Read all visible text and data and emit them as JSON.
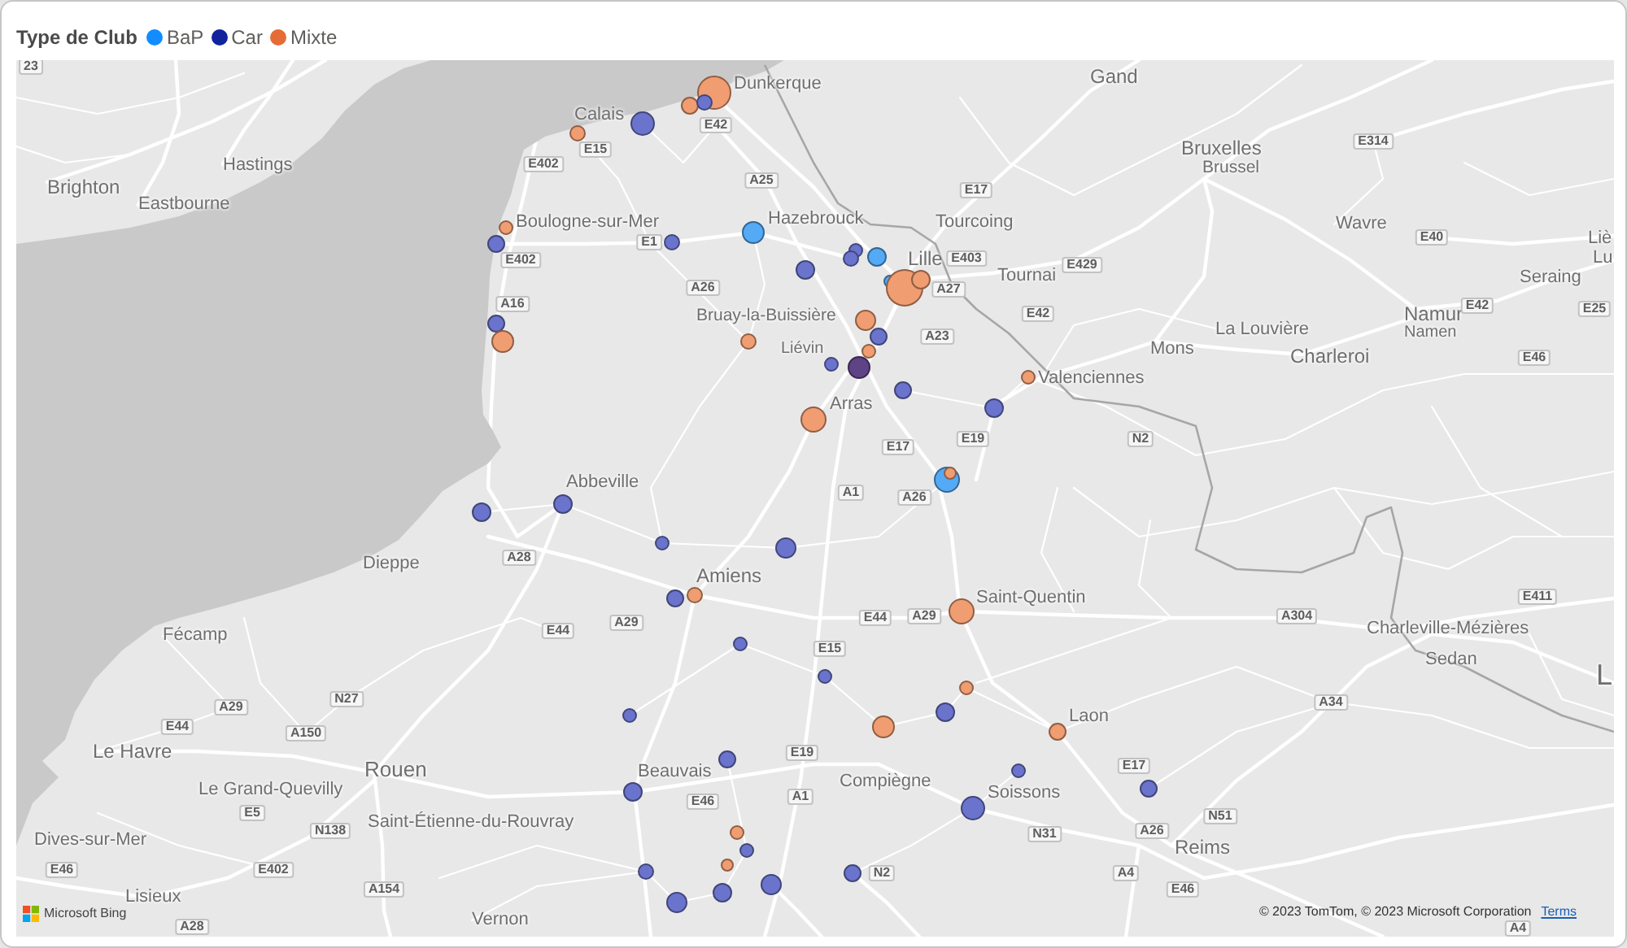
{
  "legend": {
    "title": "Type de Club",
    "items": [
      {
        "label": "BaP",
        "color": "#118dff"
      },
      {
        "label": "Car",
        "color": "#12239e"
      },
      {
        "label": "Mixte",
        "color": "#e66c37"
      }
    ]
  },
  "map": {
    "places": [
      "Dunkerque",
      "Gand",
      "Calais",
      "Bruxelles",
      "Hastings",
      "Brussel",
      "Brighton",
      "Eastbourne",
      "Boulogne-sur-Mer",
      "Hazebrouck",
      "Tourcoing",
      "Wavre",
      "Liè",
      "Lille",
      "Lu",
      "Tournai",
      "Seraing",
      "Bruay-la-Buissière",
      "Namur",
      "La Louvière",
      "Namen",
      "Liévin",
      "Mons",
      "Charleroi",
      "Valenciennes",
      "Arras",
      "Abbeville",
      "Dieppe",
      "Amiens",
      "Saint-Quentin",
      "Fécamp",
      "Charleville-Mézières",
      "Sedan",
      "L",
      "Laon",
      "Le Havre",
      "Rouen",
      "Beauvais",
      "Le Grand-Quevilly",
      "Compiègne",
      "Soissons",
      "Saint-Étienne-du-Rouvray",
      "Dives-sur-Mer",
      "Reims",
      "Lisieux",
      "Vernon"
    ],
    "road_signs": [
      "23",
      "E42",
      "E15",
      "E314",
      "E402",
      "A25",
      "E17",
      "E1",
      "E40",
      "E402",
      "E403",
      "E429",
      "A26",
      "A27",
      "A16",
      "E42",
      "E42",
      "E25",
      "A23",
      "E46",
      "E17",
      "E19",
      "N2",
      "A1",
      "A26",
      "A28",
      "E411",
      "E44",
      "A29",
      "E44",
      "A29",
      "A304",
      "E15",
      "A29",
      "N27",
      "A34",
      "E44",
      "A150",
      "E19",
      "E17",
      "E46",
      "A1",
      "E5",
      "N51",
      "N138",
      "N31",
      "A26",
      "E46",
      "E402",
      "N2",
      "A4",
      "A154",
      "E46",
      "A28",
      "A4"
    ],
    "bubbles": [
      {
        "color": "#f09d72"
      },
      {
        "color": "#f09d72"
      },
      {
        "color": "#6b74cc"
      },
      {
        "color": "#6b74cc"
      },
      {
        "color": "#f09d72"
      },
      {
        "color": "#f09d72"
      },
      {
        "color": "#55aaf5"
      },
      {
        "color": "#6b74cc"
      },
      {
        "color": "#6b74cc"
      },
      {
        "color": "#6b74cc"
      },
      {
        "color": "#6b74cc"
      },
      {
        "color": "#55aaf5"
      },
      {
        "color": "#6b74cc"
      },
      {
        "color": "#55aaf5"
      },
      {
        "color": "#f09d72"
      },
      {
        "color": "#f09d72"
      },
      {
        "color": "#f09d72"
      },
      {
        "color": "#6b74cc"
      },
      {
        "color": "#6b74cc"
      },
      {
        "color": "#f09d72"
      },
      {
        "color": "#f09d72"
      },
      {
        "color": "#f09d72"
      },
      {
        "color": "#6b74cc"
      },
      {
        "color": "#5e4387"
      },
      {
        "color": "#f09d72"
      },
      {
        "color": "#6b74cc"
      },
      {
        "color": "#6b74cc"
      },
      {
        "color": "#f09d72"
      },
      {
        "color": "#55aaf5"
      },
      {
        "color": "#f09d72"
      },
      {
        "color": "#6b74cc"
      },
      {
        "color": "#6b74cc"
      },
      {
        "color": "#6b74cc"
      },
      {
        "color": "#6b74cc"
      },
      {
        "color": "#f09d72"
      },
      {
        "color": "#6b74cc"
      },
      {
        "color": "#f09d72"
      },
      {
        "color": "#6b74cc"
      },
      {
        "color": "#6b74cc"
      },
      {
        "color": "#f09d72"
      },
      {
        "color": "#6b74cc"
      },
      {
        "color": "#6b74cc"
      },
      {
        "color": "#f09d72"
      },
      {
        "color": "#f09d72"
      },
      {
        "color": "#6b74cc"
      },
      {
        "color": "#6b74cc"
      },
      {
        "color": "#6b74cc"
      },
      {
        "color": "#6b74cc"
      },
      {
        "color": "#6b74cc"
      },
      {
        "color": "#f09d72"
      },
      {
        "color": "#6b74cc"
      },
      {
        "color": "#f09d72"
      },
      {
        "color": "#6b74cc"
      },
      {
        "color": "#6b74cc"
      },
      {
        "color": "#6b74cc"
      },
      {
        "color": "#6b74cc"
      },
      {
        "color": "#6b74cc"
      }
    ],
    "logo": "Microsoft Bing",
    "copyright": "© 2023 TomTom, © 2023 Microsoft Corporation",
    "terms_link": "Terms"
  }
}
